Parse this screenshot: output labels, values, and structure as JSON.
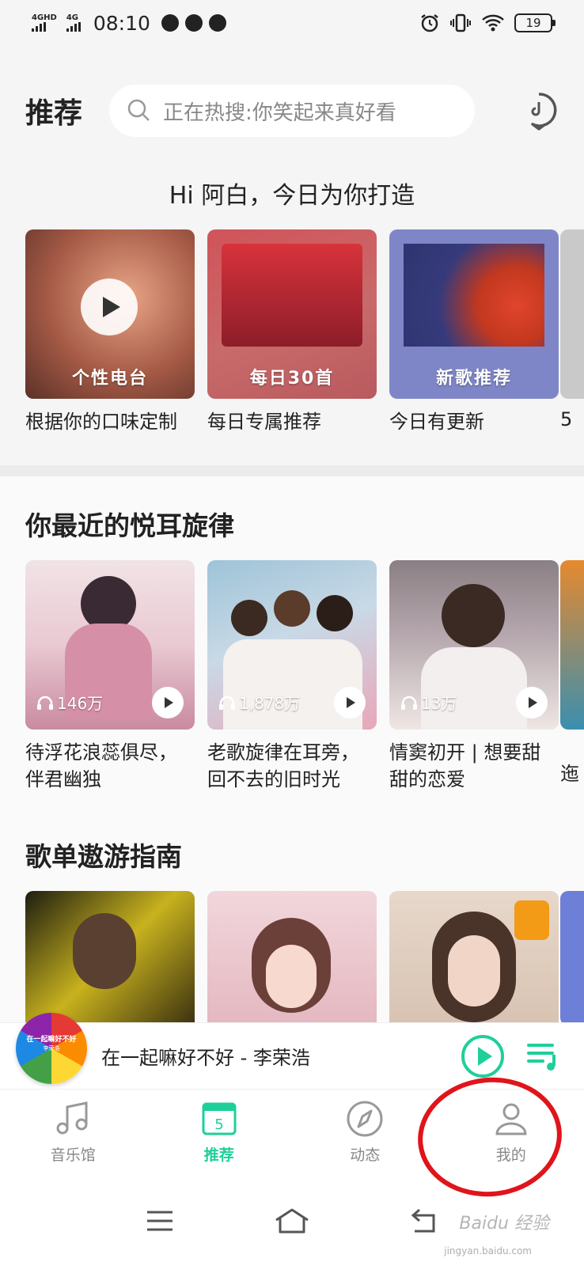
{
  "status_bar": {
    "sim1_label": "4GHD",
    "sim2_label": "4G",
    "time": "08:10",
    "battery": "19"
  },
  "header": {
    "title": "推荐",
    "search_placeholder": "正在热搜:你笑起来真好看"
  },
  "greeting": "Hi 阿白，今日为你打造",
  "daily": {
    "items": [
      {
        "label": "个性电台",
        "caption": "根据你的口味定制",
        "color": "#b87562"
      },
      {
        "label": "每日30首",
        "caption": "每日专属推荐",
        "color": "#c96a6a"
      },
      {
        "label": "新歌推荐",
        "caption": "今日有更新",
        "color": "#7f86c7"
      }
    ],
    "peek_caption": "5"
  },
  "recent": {
    "title": "你最近的悦耳旋律",
    "items": [
      {
        "plays": "146万",
        "caption": "待浮花浪蕊俱尽，伴君幽独",
        "color": "#e9c9d2"
      },
      {
        "plays": "1,878万",
        "caption": "老歌旋律在耳旁，回不去的旧时光",
        "color": "#c9d9e6"
      },
      {
        "plays": "13万",
        "caption": "情窦初开 | 想要甜甜的恋爱",
        "color": "#b6a8ae"
      }
    ],
    "peek_caption": "迤"
  },
  "guide": {
    "title": "歌单遨游指南",
    "colors": [
      "#c8b21e",
      "#e4b8c0",
      "#d8c3b2"
    ]
  },
  "player": {
    "disc_title": "在一起嘛好不好",
    "disc_sub": "李荣浩",
    "track": "在一起嘛好不好 - 李荣浩"
  },
  "tabs": [
    {
      "label": "音乐馆",
      "icon": "music-note-icon"
    },
    {
      "label": "推荐",
      "icon": "calendar-icon",
      "badge": "5"
    },
    {
      "label": "动态",
      "icon": "compass-icon"
    },
    {
      "label": "我的",
      "icon": "person-icon"
    }
  ],
  "watermark": {
    "brand": "Baidu 经验",
    "url": "jingyan.baidu.com"
  },
  "accent": "#1fcf9a"
}
